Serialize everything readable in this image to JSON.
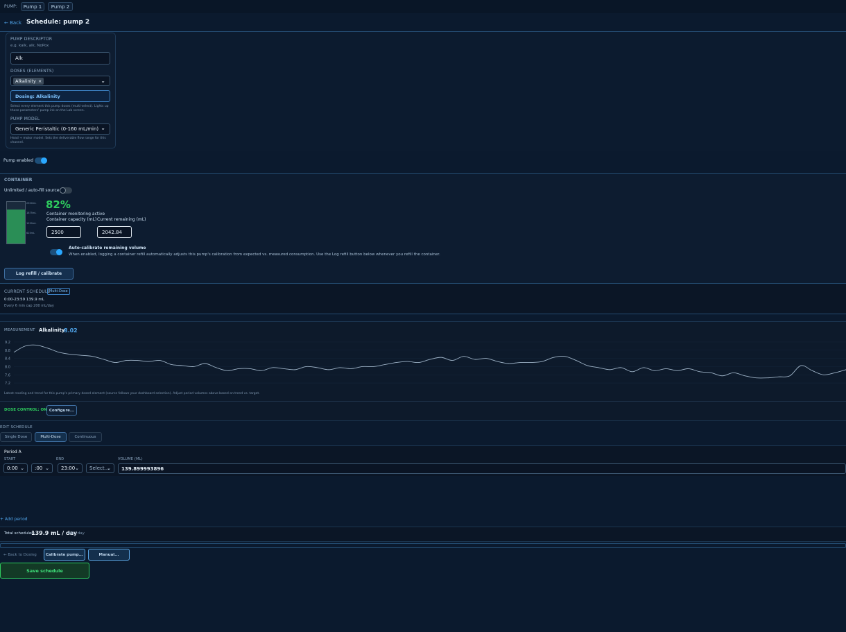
{
  "topbar": {
    "pump_label": "PUMP:",
    "pumps": [
      "Pump 1",
      "Pump 2"
    ]
  },
  "header": {
    "back": "← Back",
    "title": "Schedule: pump 2"
  },
  "descriptor": {
    "label": "PUMP DESCRIPTOR",
    "hint": "e.g. kalk, alk, NoPox",
    "value": "Alk",
    "doses_label": "DOSES (ELEMENTS)",
    "chip": "Alkalinity",
    "dosing_box": "Dosing: Alkalinity",
    "doses_help": "Select every element this pump doses (multi-select). Lights up those parameters' pump ink on the Lab screen.",
    "model_label": "PUMP MODEL",
    "model_value": "Generic Peristaltic (0-160 mL/min)",
    "model_help": "Head + motor model. Sets the deliverable flow range for this channel."
  },
  "pump_enabled": {
    "label": "Pump enabled",
    "on": true
  },
  "container": {
    "title": "CONTAINER",
    "unlimited_label": "Unlimited / auto-fill source",
    "unlimited_on": false,
    "percent": "82%",
    "fill_fraction": 0.82,
    "monitoring": "Container monitoring active",
    "capacity_label": "Container capacity (mL)",
    "remaining_label": "Current remaining (mL)",
    "capacity": "2500",
    "remaining": "2042.84",
    "scale_ticks": [
      "2500mL",
      "1875mL",
      "1250mL",
      "625mL"
    ],
    "autocal_title": "Auto-calibrate remaining volume",
    "autocal_desc": "When enabled, logging a container refill automatically adjusts this pump's calibration from expected vs. measured consumption. Use the Log refill button below whenever you refill the container.",
    "autocal_on": true,
    "log_button": "Log refill / calibrate"
  },
  "current_schedule": {
    "label": "CURRENT SCHEDULE",
    "badge": "Multi-Dose",
    "line1": "0:00-23:59 139.9 mL",
    "line2": "Every 6 min cap 200 mL/day"
  },
  "measurement": {
    "label": "MEASUREMENT",
    "element": "Alkalinity",
    "value": "8.02",
    "yticks": [
      "9.2",
      "8.8",
      "8.4",
      "8.0",
      "7.6",
      "7.2"
    ],
    "footnote": "Latest reading and trend for this pump's primary dosed element (source follows your dashboard selection). Adjust period volumes above based on trend vs. target.",
    "dose_control": "DOSE CONTROL: ON",
    "configure": "Configure..."
  },
  "chart_data": {
    "type": "line",
    "ylim": [
      7.0,
      9.3
    ],
    "yticks": [
      9.2,
      8.8,
      8.4,
      8.0,
      7.6,
      7.2
    ],
    "series": [
      {
        "values": [
          8.7,
          9.0,
          9.05,
          8.9,
          8.7,
          8.6,
          8.55,
          8.5,
          8.35,
          8.2,
          8.3,
          8.3,
          8.25,
          8.3,
          8.1,
          8.05,
          8.0,
          8.15,
          7.95,
          7.8,
          7.9,
          7.9,
          7.8,
          7.95,
          7.9,
          7.85,
          8.0,
          7.95,
          7.85,
          7.95,
          7.9,
          8.0,
          8.0,
          8.1,
          8.2,
          8.25,
          8.2,
          8.35,
          8.45,
          8.3,
          8.5,
          8.35,
          8.4,
          8.25,
          8.15,
          8.2,
          8.2,
          8.25,
          8.45,
          8.5,
          8.3,
          8.05,
          7.95,
          7.85,
          7.95,
          7.75,
          7.95,
          7.8,
          7.9,
          7.8,
          7.9,
          7.75,
          7.7,
          7.55,
          7.7,
          7.55,
          7.45,
          7.45,
          7.5,
          7.55,
          8.05,
          7.8,
          7.6,
          7.7,
          7.85
        ]
      }
    ]
  },
  "edit_schedule": {
    "label": "EDIT SCHEDULE",
    "modes": [
      "Single Dose",
      "Multi-Dose",
      "Continuous"
    ],
    "period_title": "Period A",
    "start_label": "START",
    "end_label": "END",
    "volume_label": "VOLUME (ML)",
    "start_hour": "0:00",
    "start_min": ":00",
    "end_hour": "23:00",
    "end_min": "Select...",
    "volume": "139.899993896",
    "add_period": "+ Add period",
    "total_label": "Total scheduled:",
    "total_value": "139.9 mL / day",
    "total_unit": "mL / day"
  },
  "footer": {
    "back_dosing": "← Back to Dosing",
    "calibrate": "Calibrate pump...",
    "manual": "Manual...",
    "save": "Save schedule"
  }
}
